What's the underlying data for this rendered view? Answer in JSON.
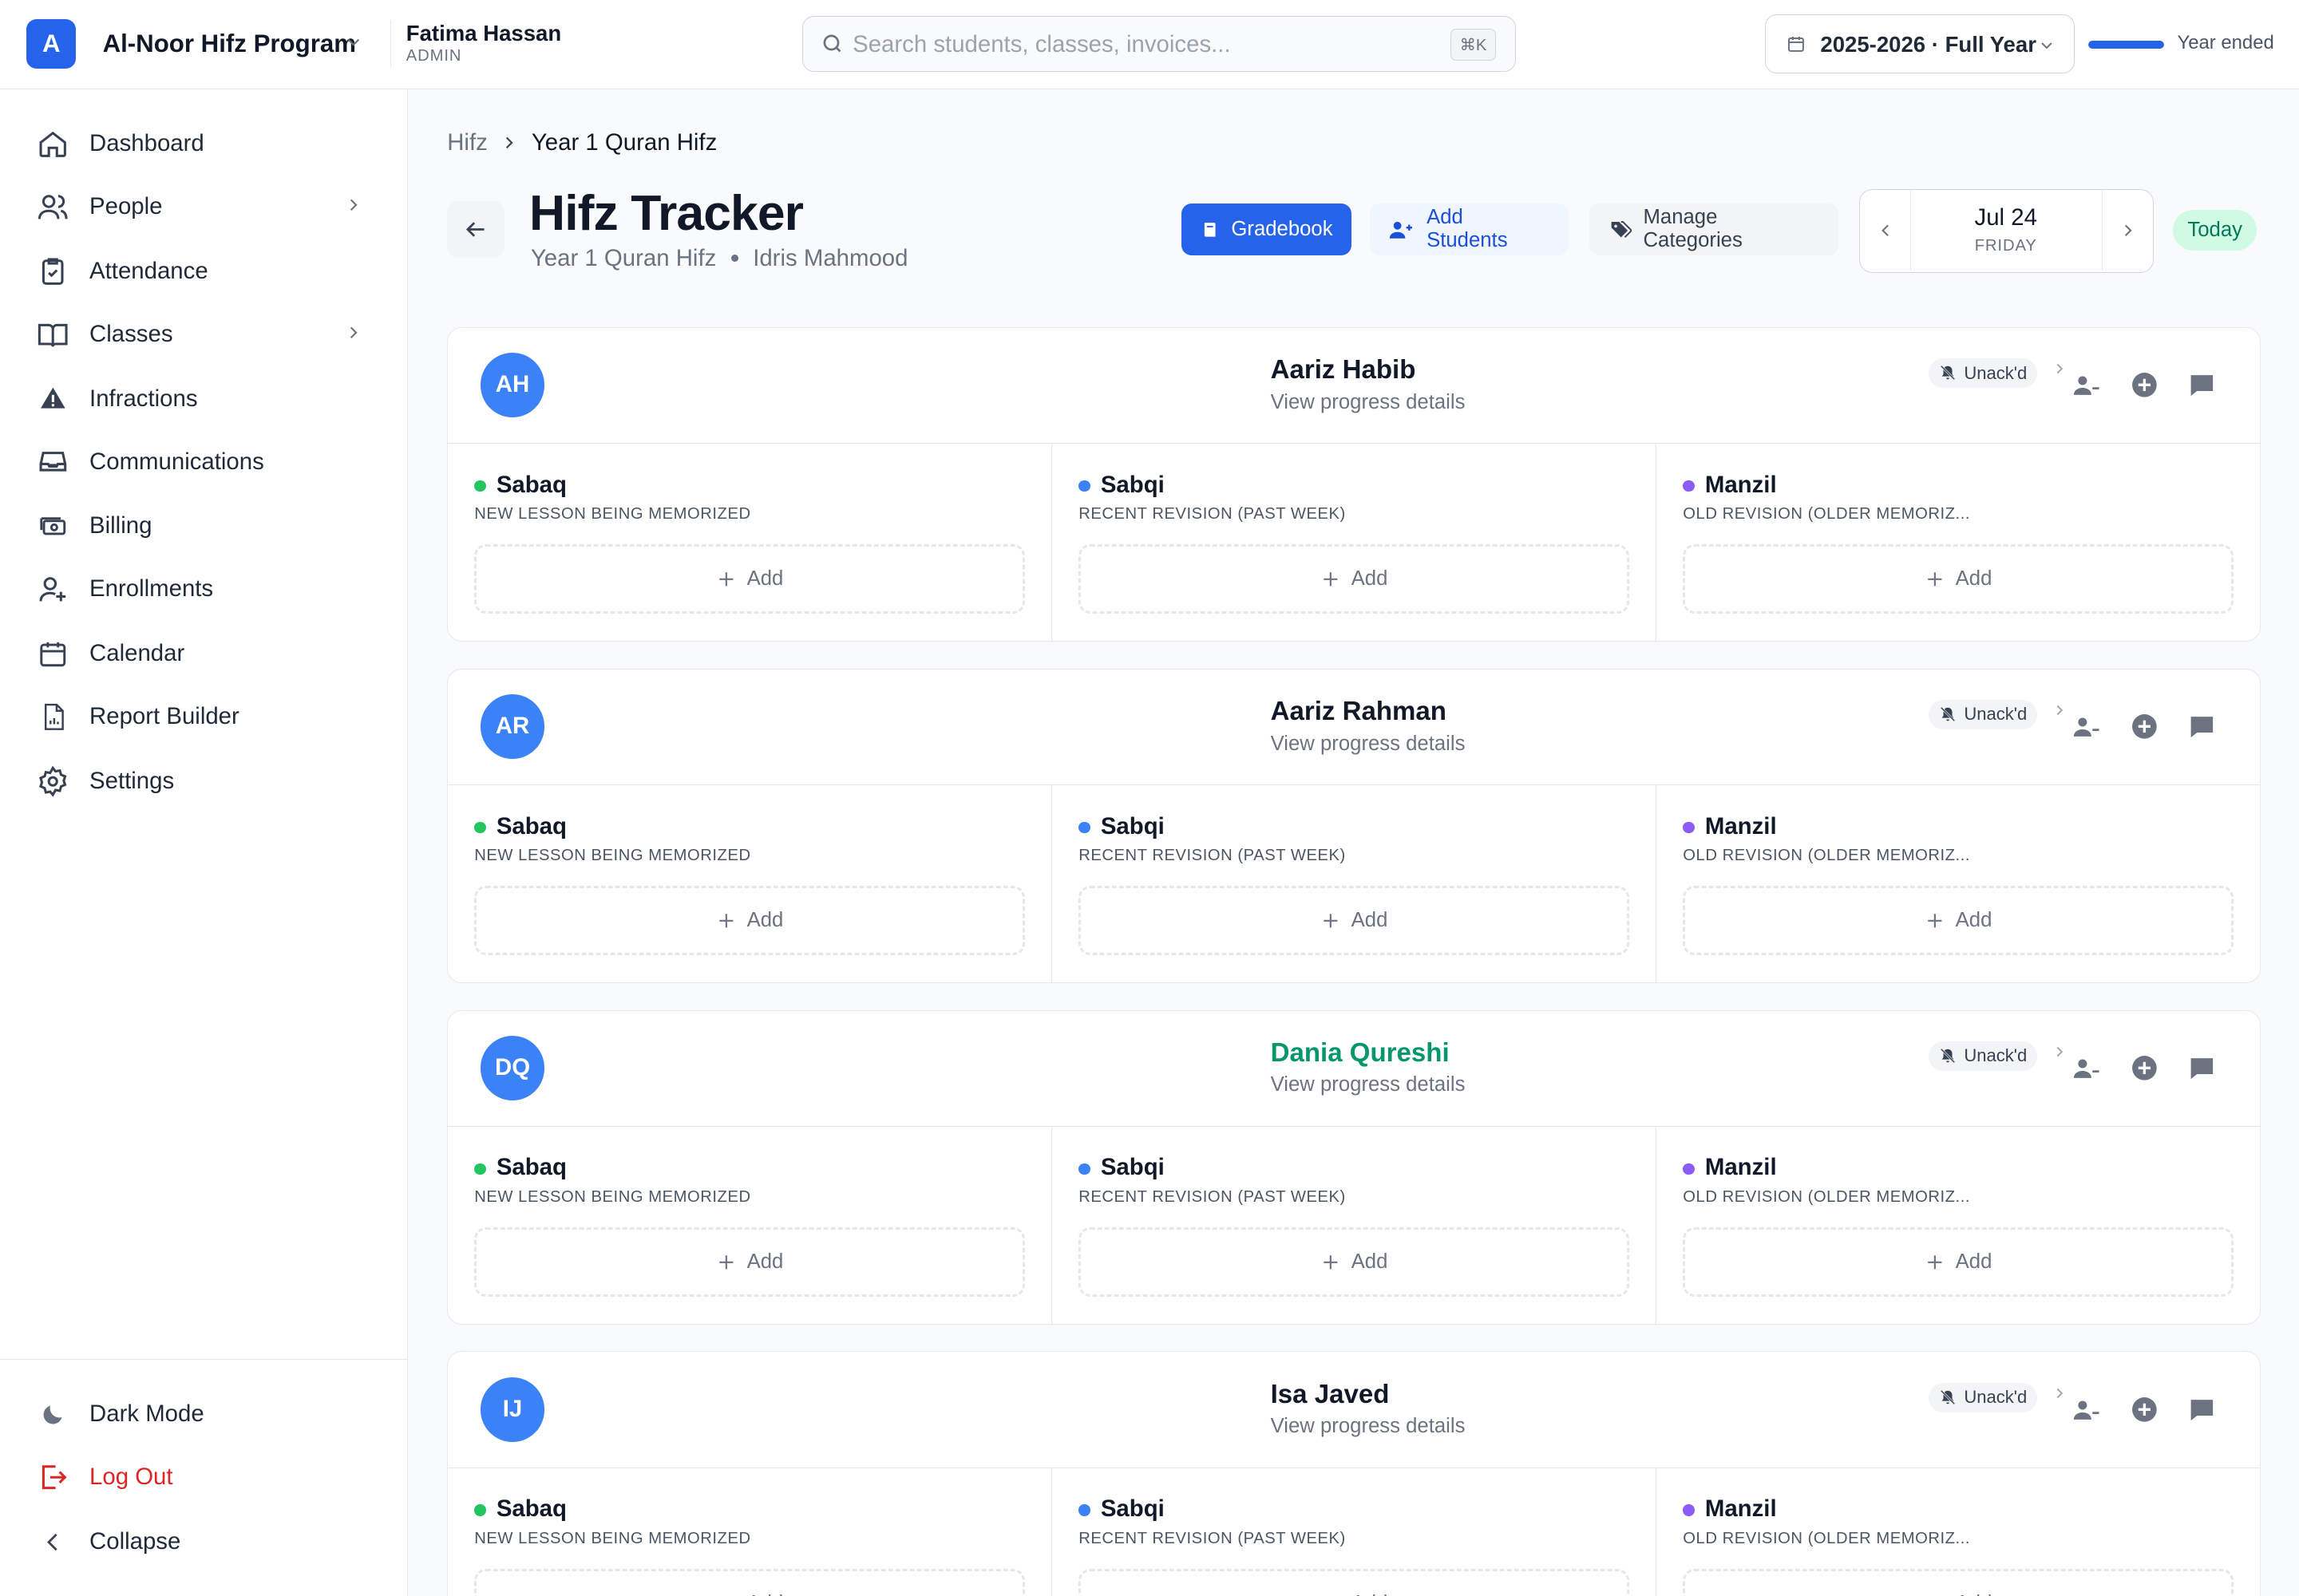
{
  "org": {
    "logo_letter": "A",
    "name": "Al-Noor Hifz Program"
  },
  "user": {
    "name": "Fatima Hassan",
    "role": "ADMIN"
  },
  "search": {
    "placeholder": "Search students, classes, invoices...",
    "shortcut": "⌘K"
  },
  "year": {
    "label": "2025-2026 · Full Year",
    "progress_percent": 100,
    "status": "Year ended"
  },
  "sidebar": {
    "items": [
      {
        "label": "Dashboard",
        "icon": "home-icon"
      },
      {
        "label": "People",
        "icon": "users-icon",
        "has_chevron": true
      },
      {
        "label": "Attendance",
        "icon": "clipboard-check-icon"
      },
      {
        "label": "Classes",
        "icon": "book-open-icon",
        "has_chevron": true
      },
      {
        "label": "Infractions",
        "icon": "warning-icon"
      },
      {
        "label": "Communications",
        "icon": "inbox-icon"
      },
      {
        "label": "Billing",
        "icon": "cash-icon"
      },
      {
        "label": "Enrollments",
        "icon": "user-plus-icon"
      },
      {
        "label": "Calendar",
        "icon": "calendar-icon"
      },
      {
        "label": "Report Builder",
        "icon": "report-icon"
      },
      {
        "label": "Settings",
        "icon": "gear-icon"
      }
    ],
    "bottom": [
      {
        "label": "Dark Mode",
        "icon": "moon-icon"
      },
      {
        "label": "Log Out",
        "icon": "logout-icon",
        "color": "#dc2626"
      },
      {
        "label": "Collapse",
        "icon": "chevron-left-icon"
      }
    ]
  },
  "breadcrumb": {
    "root": "Hifz",
    "current": "Year 1 Quran Hifz"
  },
  "page": {
    "title": "Hifz Tracker",
    "class_name": "Year 1 Quran Hifz",
    "teacher": "Idris Mahmood"
  },
  "actions": {
    "gradebook": "Gradebook",
    "add_students": "Add Students",
    "manage_categories": "Manage Categories"
  },
  "date": {
    "date": "Jul 24",
    "weekday": "FRIDAY",
    "today_label": "Today"
  },
  "colors": {
    "accent": "#2563eb",
    "sabaq": "#22c55e",
    "sabqi": "#3b82f6",
    "manzil": "#8b5cf6",
    "highlight": "#059669",
    "logout": "#dc2626"
  },
  "categories": [
    {
      "name": "Sabaq",
      "description": "NEW LESSON BEING MEMORIZED",
      "color": "#22c55e"
    },
    {
      "name": "Sabqi",
      "description": "RECENT REVISION (PAST WEEK)",
      "color": "#3b82f6"
    },
    {
      "name": "Manzil",
      "description": "OLD REVISION (OLDER MEMORIZ...",
      "color": "#8b5cf6"
    }
  ],
  "card_labels": {
    "view_progress": "View progress details",
    "unack": "Unack'd",
    "add": "Add"
  },
  "students": [
    {
      "initials": "AH",
      "name": "Aariz Habib",
      "highlighted": false
    },
    {
      "initials": "AR",
      "name": "Aariz Rahman",
      "highlighted": false
    },
    {
      "initials": "DQ",
      "name": "Dania Qureshi",
      "highlighted": true
    },
    {
      "initials": "IJ",
      "name": "Isa Javed",
      "highlighted": false
    }
  ]
}
